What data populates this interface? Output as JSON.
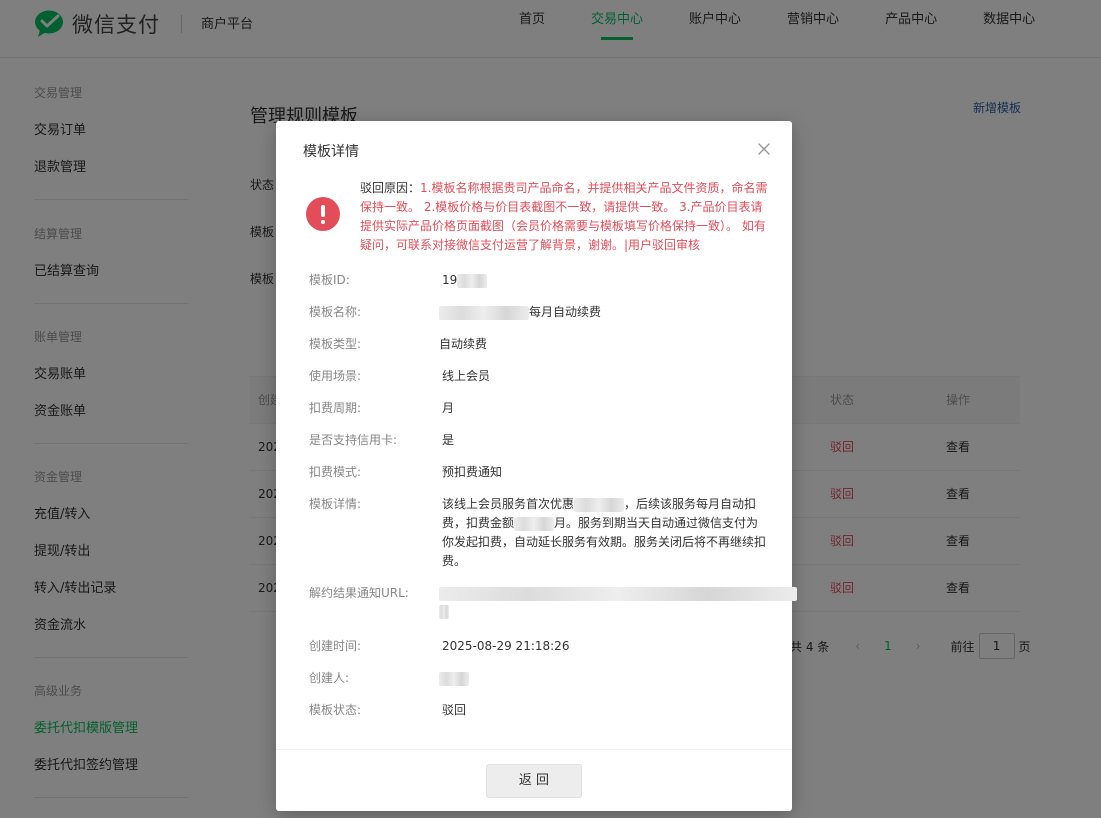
{
  "header": {
    "brand": "微信支付",
    "platform": "商户平台",
    "nav": [
      {
        "label": "首页",
        "active": false
      },
      {
        "label": "交易中心",
        "active": true
      },
      {
        "label": "账户中心",
        "active": false
      },
      {
        "label": "营销中心",
        "active": false
      },
      {
        "label": "产品中心",
        "active": false
      },
      {
        "label": "数据中心",
        "active": false
      }
    ]
  },
  "sidebar": {
    "groups": [
      {
        "title": "交易管理",
        "items": [
          "交易订单",
          "退款管理"
        ]
      },
      {
        "title": "结算管理",
        "items": [
          "已结算查询"
        ]
      },
      {
        "title": "账单管理",
        "items": [
          "交易账单",
          "资金账单"
        ]
      },
      {
        "title": "资金管理",
        "items": [
          "充值/转入",
          "提现/转出",
          "转入/转出记录",
          "资金流水"
        ]
      },
      {
        "title": "高级业务",
        "items": [
          "委托代扣模版管理",
          "委托代扣签约管理"
        ]
      }
    ],
    "active_item": "委托代扣模版管理"
  },
  "main": {
    "title": "管理规则模板",
    "add_link": "新增模板",
    "filter_labels": [
      "状态",
      "模板",
      "模板"
    ],
    "table": {
      "headers": [
        "创建",
        "状态",
        "操作"
      ],
      "rows": [
        {
          "date": "202",
          "status": "驳回",
          "action": "查看"
        },
        {
          "date": "202",
          "status": "驳回",
          "action": "查看"
        },
        {
          "date": "202",
          "status": "驳回",
          "action": "查看"
        },
        {
          "date": "202",
          "status": "驳回",
          "action": "查看"
        }
      ]
    },
    "pagination": {
      "total": "共 4 条",
      "current": "1",
      "goto": "前往",
      "goto_value": "1",
      "page_unit": "页"
    }
  },
  "dialog": {
    "title": "模板详情",
    "reason_label": "驳回原因：",
    "reason_text": "1.模板名称根据贵司产品命名，并提供相关产品文件资质，命名需保持一致。 2.模板价格与价目表截图不一致，请提供一致。 3.产品价目表请提供实际产品价格页面截图（会员价格需要与模板填写价格保持一致）。 如有疑问，可联系对接微信支付运营了解背景，谢谢。|用户驳回审核",
    "fields": {
      "template_id_label": "模板ID:",
      "template_id_value": "19",
      "name_label": "模板名称:",
      "name_value": "每月自动续费",
      "type_label": "模板类型:",
      "type_value": "自动续费",
      "scene_label": "使用场景:",
      "scene_value": "线上会员",
      "cycle_label": "扣费周期:",
      "cycle_value": "月",
      "credit_label": "是否支持信用卡:",
      "credit_value": "是",
      "mode_label": "扣费模式:",
      "mode_value": "预扣费通知",
      "detail_label": "模板详情:",
      "detail_part1": "该线上会员服务首次优惠",
      "detail_part2": "，后续该服务每月自动扣费，扣费金额",
      "detail_part3": "月。服务到期当天自动通过微信支付为你发起扣费，自动延长服务有效期。服务关闭后将不再继续扣费。",
      "url_label": "解约结果通知URL:",
      "created_label": "创建时间:",
      "created_value": "2025-08-29 21:18:26",
      "creator_label": "创建人:",
      "status_label": "模板状态:",
      "status_value": "驳回"
    },
    "back_button": "返 回"
  },
  "colors": {
    "brand_green": "#07c160",
    "reject_red": "#e34d59",
    "link_blue": "#2b5fa5"
  }
}
